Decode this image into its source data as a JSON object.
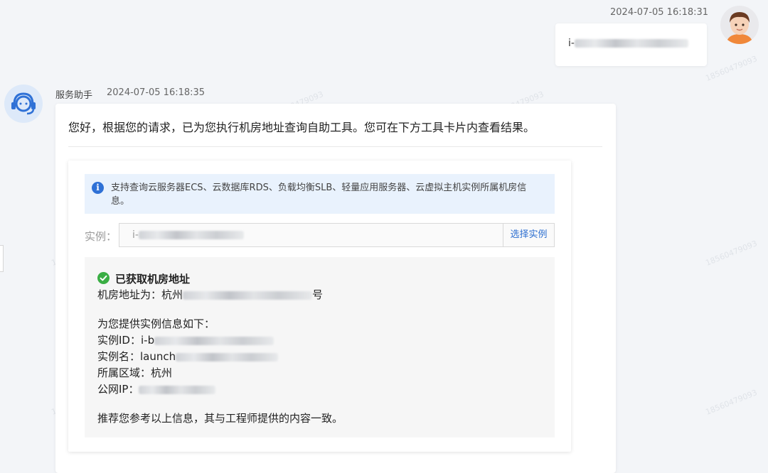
{
  "user_message": {
    "timestamp": "2024-07-05 16:18:31",
    "text_prefix": "i-"
  },
  "bot_message": {
    "sender": "服务助手",
    "timestamp": "2024-07-05 16:18:35",
    "greeting": "您好，根据您的请求，已为您执行机房地址查询自助工具。您可在下方工具卡片内查看结果。"
  },
  "tool": {
    "notice": "支持查询云服务器ECS、云数据库RDS、负载均衡SLB、轻量应用服务器、云虚拟主机实例所属机房信息。",
    "instance_label": "实例：",
    "instance_value_prefix": "i-",
    "select_button": "选择实例",
    "result": {
      "title": "已获取机房地址",
      "address_label": "机房地址为：",
      "address_prefix": "杭州",
      "address_suffix": "号",
      "info_heading": "为您提供实例信息如下：",
      "instance_id_label": "实例ID：",
      "instance_id_prefix": "i-b",
      "instance_name_label": "实例名：",
      "instance_name_prefix": "launch",
      "region_label": "所属区域：",
      "region_value": "杭州",
      "public_ip_label": "公网IP：",
      "footer": "推荐您参考以上信息，其与工程师提供的内容一致。"
    }
  },
  "colors": {
    "accent": "#2c6ed0",
    "info_bg": "#e9f2fd",
    "success": "#3aae44"
  },
  "watermark_text": "18560479093"
}
